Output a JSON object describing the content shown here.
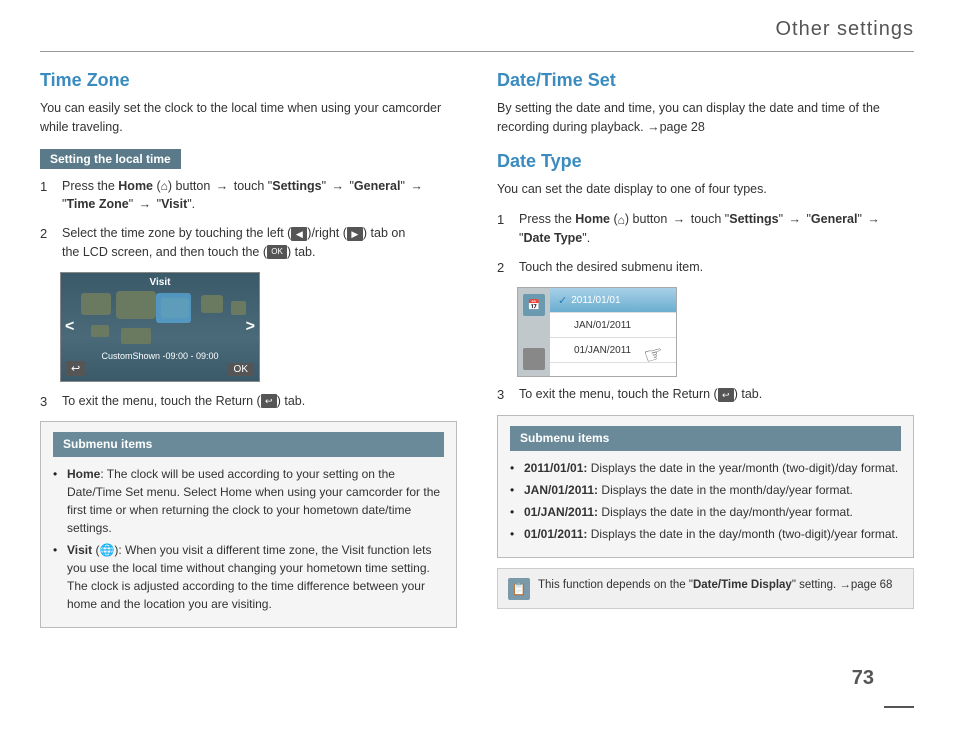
{
  "header": {
    "title": "Other settings",
    "page_number": "73"
  },
  "left_column": {
    "section_title": "Time Zone",
    "section_intro": "You can easily set the clock to the local time when using your camcorder while traveling.",
    "submenu_label": "Setting the local time",
    "steps": [
      {
        "num": "1",
        "text": "Press the Home (🏠) button → touch \"Settings\" → \"General\" → \"Time Zone\" → \"Visit\"."
      },
      {
        "num": "2",
        "text": "Select the time zone by touching the left (◀)/right (▶) tab on the LCD screen, and then touch the (OK) tab."
      },
      {
        "num": "3",
        "text": "To exit the menu, touch the Return (↩) tab."
      }
    ],
    "map": {
      "visit_label": "Visit",
      "time_label": "Custom_shown -09:00 - 09:00",
      "ok_label": "OK"
    },
    "submenu_box": {
      "title": "Submenu items",
      "items": [
        {
          "label": "Home",
          "text": ": The clock will be used according to your setting on the Date/Time Set menu. Select Home when using your camcorder for the first time or when returning the clock to your hometown date/time settings."
        },
        {
          "label": "Visit (🌐)",
          "text": ": When you visit a different time zone, the Visit function lets you use the local time without changing your hometown time setting. The clock is adjusted according to the time difference between your home and the location you are visiting."
        }
      ]
    }
  },
  "right_column": {
    "section1": {
      "title": "Date/Time Set",
      "intro": "By setting the date and time, you can display the date and time of the recording during playback. →page 28"
    },
    "section2": {
      "title": "Date Type",
      "intro": "You can set the date display to one of four types.",
      "steps": [
        {
          "num": "1",
          "text": "Press the Home (🏠) button → touch \"Settings\" → \"General\" → \"Date Type\"."
        },
        {
          "num": "2",
          "text": "Touch the desired submenu item."
        },
        {
          "num": "3",
          "text": "To exit the menu, touch the Return (↩) tab."
        }
      ],
      "submenu_box": {
        "title": "Submenu items",
        "items": [
          {
            "label": "2011/01/01:",
            "text": " Displays the date in the year/month (two-digit)/day format."
          },
          {
            "label": "JAN/01/2011:",
            "text": " Displays the date in the month/day/year format."
          },
          {
            "label": "01/JAN/2011:",
            "text": " Displays the date in the day/month/year format."
          },
          {
            "label": "01/01/2011:",
            "text": " Displays the date in the day/month (two-digit)/year format."
          }
        ]
      }
    },
    "note": {
      "text": "This function depends on the \"Date/Time Display\" setting. →page 68"
    }
  }
}
